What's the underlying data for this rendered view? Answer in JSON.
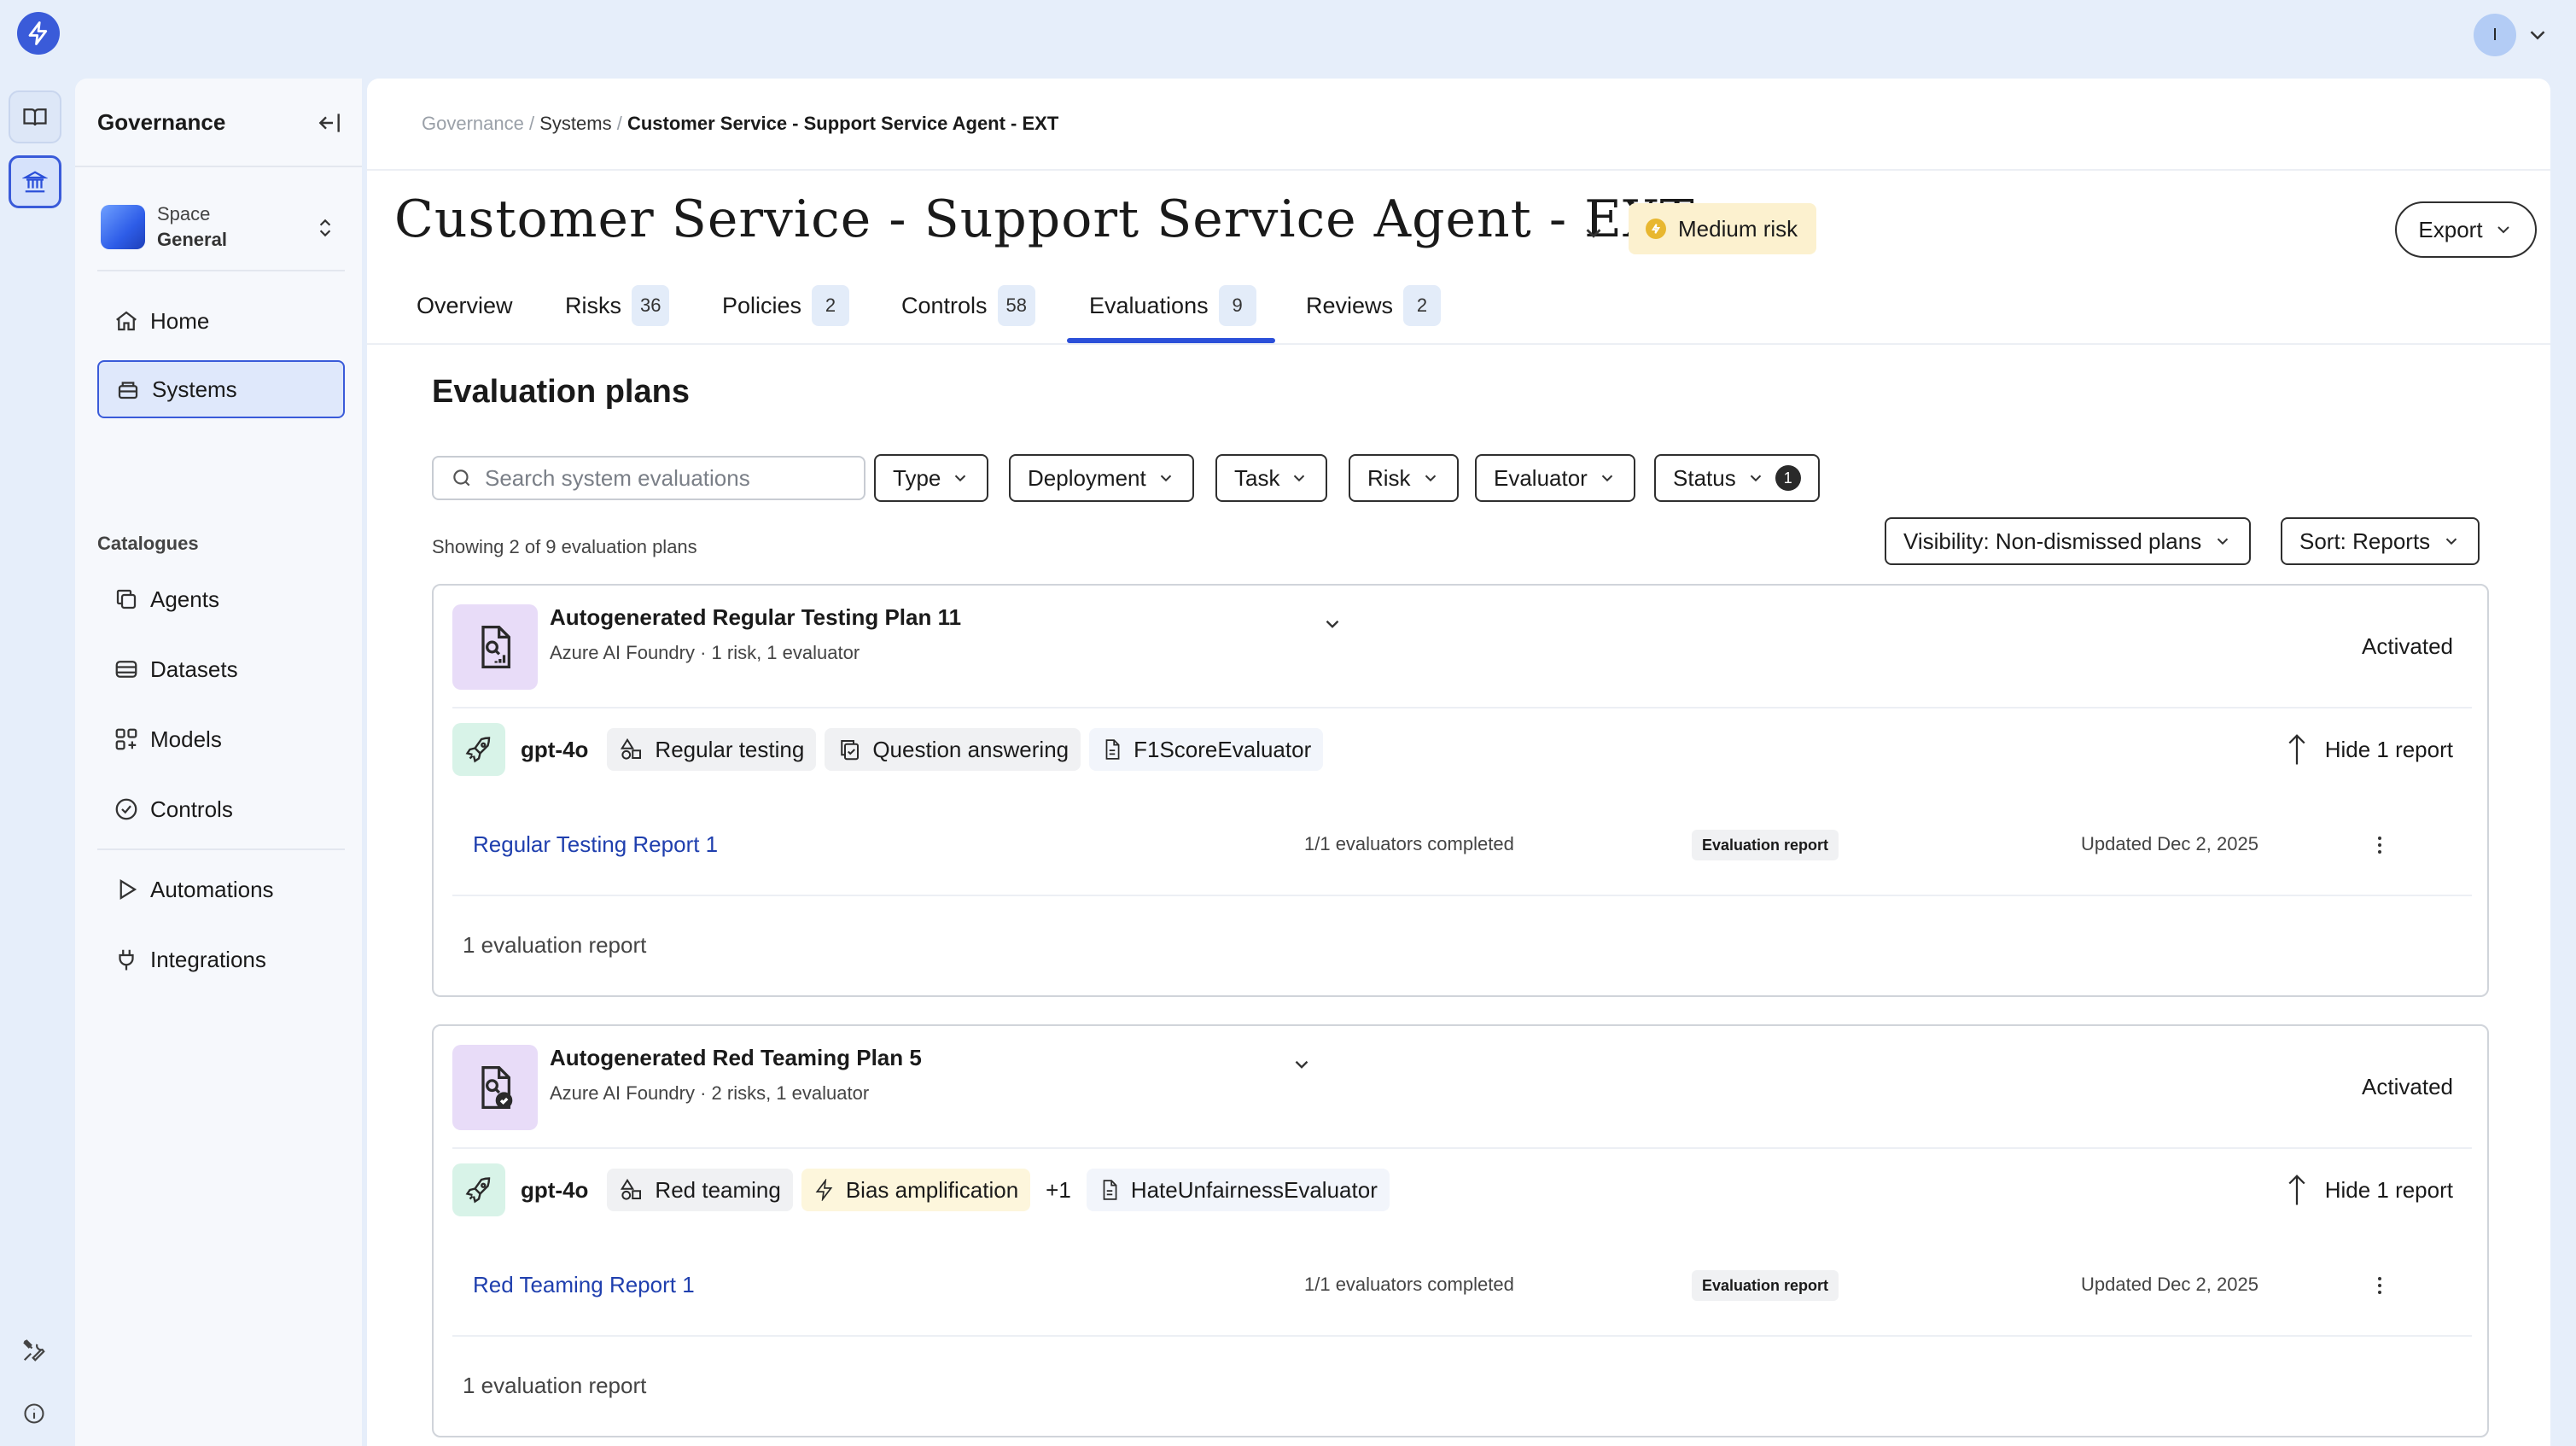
{
  "topbar": {
    "avatar_initial": "I"
  },
  "sidebar": {
    "title": "Governance",
    "space": {
      "label": "Space",
      "name": "General"
    },
    "nav_top": [
      {
        "label": "Home",
        "icon": "home-icon"
      },
      {
        "label": "Systems",
        "icon": "systems-icon"
      }
    ],
    "section_label": "Catalogues",
    "catalogues": [
      {
        "label": "Agents",
        "icon": "agents-icon"
      },
      {
        "label": "Datasets",
        "icon": "datasets-icon"
      },
      {
        "label": "Models",
        "icon": "models-icon"
      },
      {
        "label": "Controls",
        "icon": "controls-icon"
      }
    ],
    "nav_bottom": [
      {
        "label": "Automations",
        "icon": "play-icon"
      },
      {
        "label": "Integrations",
        "icon": "plug-icon"
      }
    ]
  },
  "breadcrumb": {
    "root": "Governance",
    "mid": "Systems",
    "current": "Customer Service - Support Service Agent - EXT",
    "sep": "/"
  },
  "header": {
    "title": "Customer Service - Support Service Agent - EXT",
    "risk_badge": "Medium risk",
    "export_label": "Export"
  },
  "tabs": [
    {
      "label": "Overview",
      "count": null
    },
    {
      "label": "Risks",
      "count": "36"
    },
    {
      "label": "Policies",
      "count": "2"
    },
    {
      "label": "Controls",
      "count": "58"
    },
    {
      "label": "Evaluations",
      "count": "9"
    },
    {
      "label": "Reviews",
      "count": "2"
    }
  ],
  "active_tab": "Evaluations",
  "evaluations": {
    "section_title": "Evaluation plans",
    "search_placeholder": "Search system evaluations",
    "filters": [
      "Type",
      "Deployment",
      "Task",
      "Risk",
      "Evaluator",
      "Status"
    ],
    "status_filter_count": "1",
    "showing_text": "Showing 2 of 9 evaluation plans",
    "visibility_label": "Visibility: Non-dismissed plans",
    "sort_label": "Sort: Reports",
    "plans": [
      {
        "name": "Autogenerated Regular Testing Plan 11",
        "subtitle": "Azure AI Foundry · 1 risk, 1 evaluator",
        "status": "Activated",
        "model": "gpt-4o",
        "tags": [
          {
            "label": "Regular testing",
            "icon": "shapes-icon",
            "style": "gray"
          },
          {
            "label": "Question answering",
            "icon": "clipboard-check-icon",
            "style": "gray"
          },
          {
            "label": "F1ScoreEvaluator",
            "icon": "file-icon",
            "style": "blue"
          }
        ],
        "hide_label": "Hide 1 report",
        "report": {
          "name": "Regular Testing Report 1",
          "completed": "1/1 evaluators completed",
          "badge": "Evaluation report",
          "updated": "Updated Dec 2, 2025"
        },
        "footer": "1 evaluation report"
      },
      {
        "name": "Autogenerated Red Teaming Plan 5",
        "subtitle": "Azure AI Foundry · 2 risks, 1 evaluator",
        "status": "Activated",
        "model": "gpt-4o",
        "tags": [
          {
            "label": "Red teaming",
            "icon": "shapes-icon",
            "style": "gray"
          },
          {
            "label": "Bias amplification",
            "icon": "bolt-icon",
            "style": "yellow"
          },
          {
            "label": "+1",
            "icon": null,
            "style": "plain"
          },
          {
            "label": "HateUnfairnessEvaluator",
            "icon": "file-icon",
            "style": "blue"
          }
        ],
        "hide_label": "Hide 1 report",
        "report": {
          "name": "Red Teaming Report 1",
          "completed": "1/1 evaluators completed",
          "badge": "Evaluation report",
          "updated": "Updated Dec 2, 2025"
        },
        "footer": "1 evaluation report"
      }
    ]
  }
}
